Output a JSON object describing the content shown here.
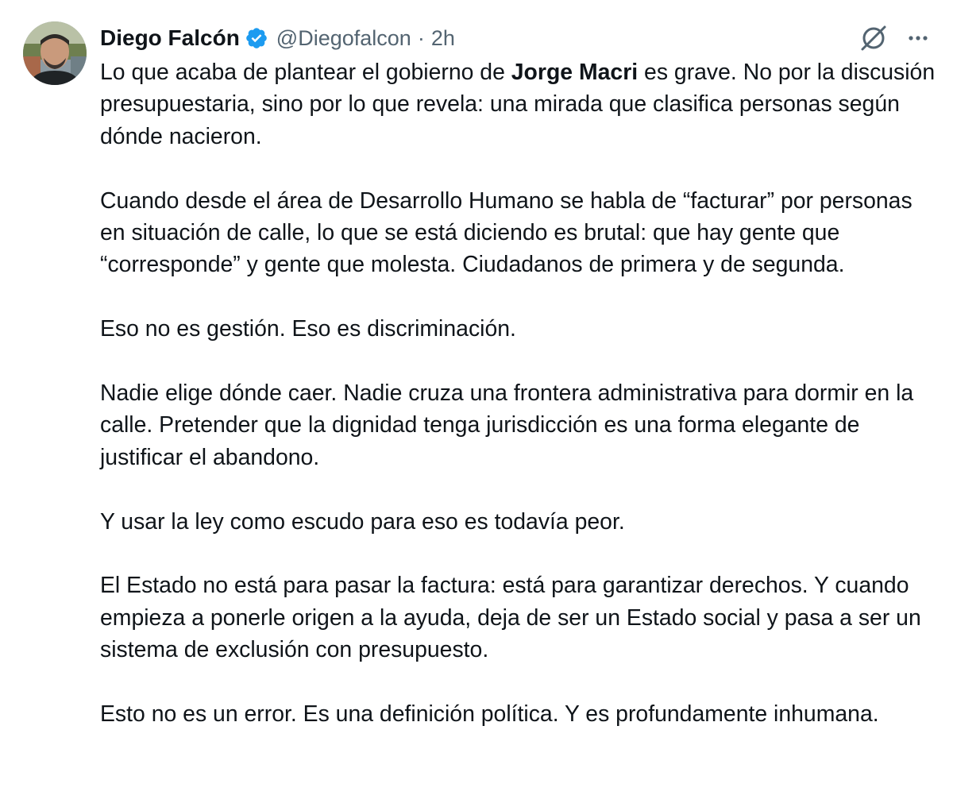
{
  "author": {
    "display_name": "Diego Falcón",
    "handle": "@Diegofalcon",
    "separator": "·",
    "time": "2h",
    "verified_color": "#1d9bf0"
  },
  "icons": {
    "verified": "verified-badge-icon",
    "grok": "grok-icon",
    "more": "more-options-icon"
  },
  "tweet": {
    "p1_before": "Lo que acaba de plantear el gobierno de ",
    "p1_bold": "Jorge Macri",
    "p1_after": " es grave. No por la discusión presupuestaria, sino por lo que revela: una mirada que clasifica personas según dónde nacieron.",
    "p2": "Cuando desde el área de Desarrollo Humano se habla de “facturar” por personas en situación de calle, lo que se está diciendo es brutal: que hay gente que “corresponde” y gente que molesta. Ciudadanos de primera y de segunda.",
    "p3": "Eso no es gestión. Eso es discriminación.",
    "p4": "Nadie elige dónde caer. Nadie cruza una frontera administrativa para dormir en la calle. Pretender que la dignidad tenga jurisdicción es una forma elegante de justificar el abandono.",
    "p5": "Y usar la ley como escudo para eso es todavía peor.",
    "p6": "El Estado no está para pasar la factura: está para garantizar derechos. Y cuando empieza a ponerle origen a la ayuda, deja de ser un Estado social y pasa a ser un sistema de exclusión con presupuesto.",
    "p7": "Esto no es un error. Es una definición política. Y es profundamente inhumana."
  }
}
